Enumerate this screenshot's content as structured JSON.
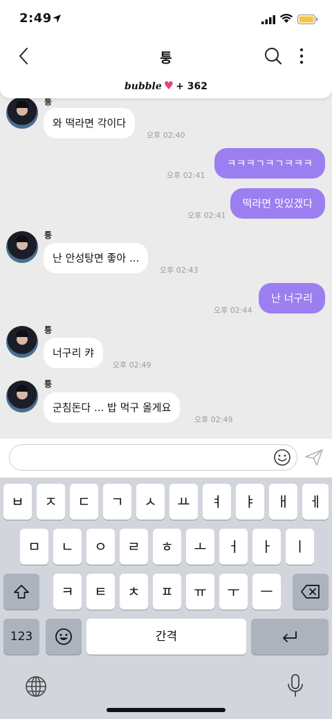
{
  "status": {
    "time": "2:49"
  },
  "nav": {
    "title": "퉁"
  },
  "bubble_bar": {
    "brand": "bubble",
    "heart": "♥",
    "count": "+ 362"
  },
  "messages": [
    {
      "side": "in",
      "sender": "퉁",
      "text": "와 떡라면 각이다",
      "time": "오후 02:40"
    },
    {
      "side": "out",
      "text": "ㅋㅋㅋㄱㅋㄱㅋㅋㅋ",
      "time": "오후 02:41"
    },
    {
      "side": "out",
      "text": "떡라면 맛있겠다",
      "time": "오후 02:41"
    },
    {
      "side": "in",
      "sender": "퉁",
      "text": "난 안성탕면 좋아 ...",
      "time": "오후 02:43"
    },
    {
      "side": "out",
      "text": "난 너구리",
      "time": "오후 02:44"
    },
    {
      "side": "in",
      "sender": "퉁",
      "text": "너구리 캬",
      "time": "오후 02:49"
    },
    {
      "side": "in",
      "sender": "퉁",
      "text": "군침돈다 ... 밥 먹구 올게요",
      "time": "오후 02:49"
    }
  ],
  "input": {
    "placeholder": ""
  },
  "keyboard": {
    "row1": [
      "ㅂ",
      "ㅈ",
      "ㄷ",
      "ㄱ",
      "ㅅ",
      "ㅛ",
      "ㅕ",
      "ㅑ",
      "ㅐ",
      "ㅔ"
    ],
    "row2": [
      "ㅁ",
      "ㄴ",
      "ㅇ",
      "ㄹ",
      "ㅎ",
      "ㅗ",
      "ㅓ",
      "ㅏ",
      "ㅣ"
    ],
    "row3": [
      "ㅋ",
      "ㅌ",
      "ㅊ",
      "ㅍ",
      "ㅠ",
      "ㅜ",
      "ㅡ"
    ],
    "numbers_key": "123",
    "space_key": "간격"
  },
  "icons": {
    "location": "location-arrow-icon",
    "signal": "signal-bars-icon",
    "wifi": "wifi-icon",
    "battery": "battery-icon",
    "back": "chevron-left-icon",
    "search": "search-icon",
    "more": "more-vertical-icon",
    "emoji": "smiley-icon",
    "send": "send-icon",
    "shift": "shift-icon",
    "delete": "backspace-icon",
    "return": "return-icon",
    "globe": "globe-icon",
    "mic": "microphone-icon"
  },
  "colors": {
    "outgoing_bubble": "#9b7ef0",
    "incoming_bubble": "#ffffff",
    "chat_bg": "#ebebeb",
    "heart": "#e0457b",
    "battery": "#f5c542"
  }
}
